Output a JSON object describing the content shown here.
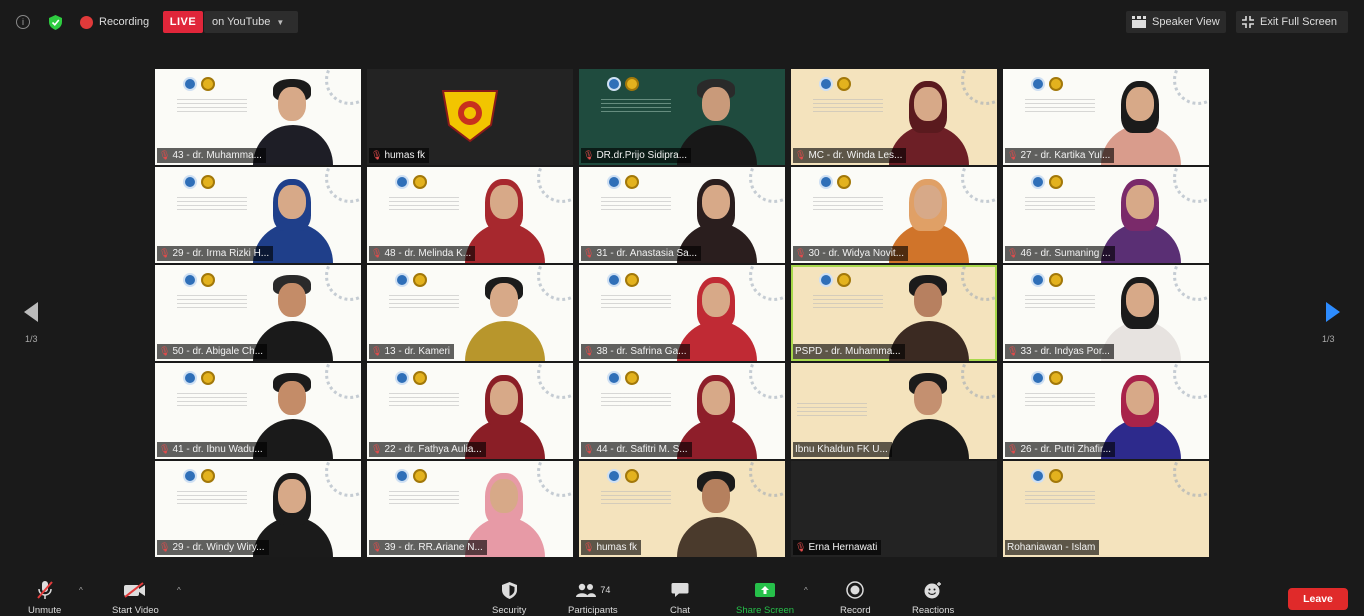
{
  "topbar": {
    "recording_label": "Recording",
    "live_label": "LIVE",
    "stream_label": "on YouTube",
    "speaker_view_label": "Speaker View",
    "exit_fullscreen_label": "Exit Full Screen"
  },
  "pagination": {
    "left": "1/3",
    "right": "1/3"
  },
  "participants": [
    "43 - dr. Muhamma...",
    "humas fk",
    "DR.dr.Prijo Sidipra...",
    "MC - dr. Winda Les...",
    "27 - dr. Kartika Yul...",
    "29 - dr. Irma Rizki H...",
    "48 - dr. Melinda K...",
    "31 - dr. Anastasia Sa...",
    "30 - dr. Widya Novit...",
    "46 - dr. Sumaning ...",
    "50 - dr. Abigale Ch...",
    "13 - dr. Kameri",
    "38 - dr. Safrina Ga...",
    "PSPD - dr. Muhamma...",
    "33 - dr. Indyas Por...",
    "41 - dr. Ibnu Wadu...",
    "22 - dr. Fathya Aulia...",
    "44 - dr. Safitri M. S...",
    "Ibnu Khaldun FK U...",
    "26 - dr. Putri Zhafir...",
    "29 - dr. Windy Wiry...",
    "39 - dr. RR.Ariane N...",
    "humas fk",
    "Erna Hernawati",
    "Rohaniawan - Islam"
  ],
  "controls": {
    "unmute": "Unmute",
    "start_video": "Start Video",
    "security": "Security",
    "participants": "Participants",
    "participants_count": "74",
    "chat": "Chat",
    "share_screen": "Share Screen",
    "record": "Record",
    "reactions": "Reactions",
    "leave": "Leave"
  },
  "colors": {
    "live": "#e0263a",
    "share": "#26c04a",
    "leave": "#e02a2a",
    "active_speaker": "#a7d84b",
    "next_arrow": "#2d8cff"
  }
}
